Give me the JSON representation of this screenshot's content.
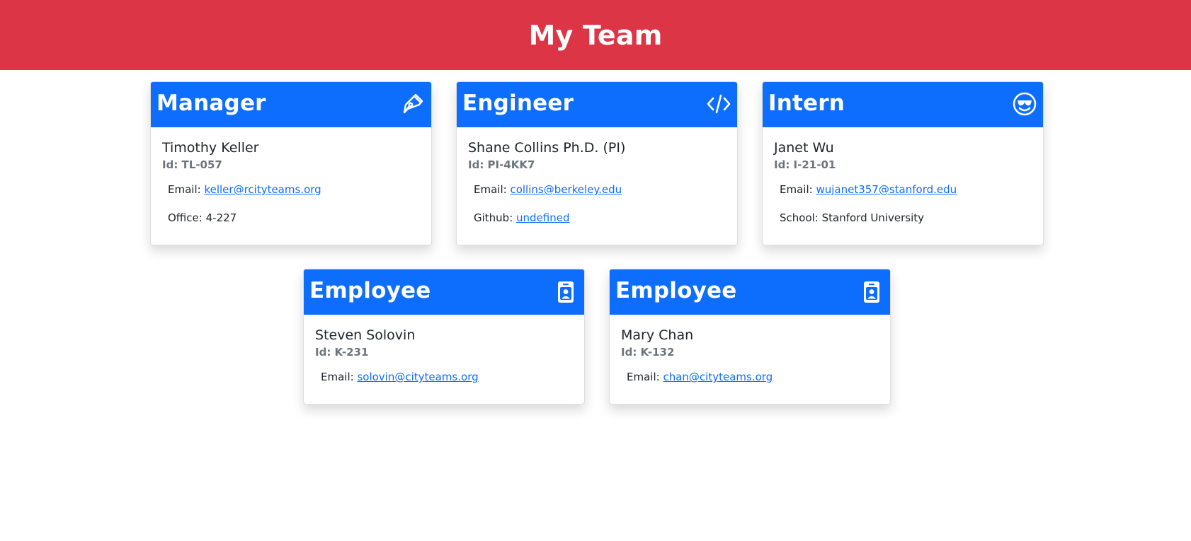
{
  "header": {
    "title": "My Team"
  },
  "cards": [
    {
      "role": "Manager",
      "icon": "pen-icon",
      "name": "Timothy Keller",
      "id_label": "Id: TL-057",
      "email_label": "Email: ",
      "email": "keller@rcityteams.org",
      "extra_label": "Office: ",
      "extra_value": "4-227"
    },
    {
      "role": "Engineer",
      "icon": "code-icon",
      "name": "Shane Collins Ph.D. (PI)",
      "id_label": "Id: PI-4KK7",
      "email_label": "Email: ",
      "email": "collins@berkeley.edu",
      "extra_label": "Github: ",
      "extra_value": "undefined"
    },
    {
      "role": "Intern",
      "icon": "sunglasses-smiley-icon",
      "name": "Janet Wu",
      "id_label": "Id: I-21-01",
      "email_label": "Email: ",
      "email": "wujanet357@stanford.edu",
      "extra_label": "School: ",
      "extra_value": "Stanford University"
    },
    {
      "role": "Employee",
      "icon": "id-badge-icon",
      "name": "Steven Solovin",
      "id_label": "Id: K-231",
      "email_label": "Email: ",
      "email": "solovin@cityteams.org"
    },
    {
      "role": "Employee",
      "icon": "id-badge-icon",
      "name": "Mary Chan",
      "id_label": "Id: K-132",
      "email_label": "Email: ",
      "email": "chan@cityteams.org"
    }
  ],
  "colors": {
    "header_bg": "#dc3545",
    "card_header_bg": "#0d6efd",
    "link": "#0d6efd",
    "muted": "#6c757d"
  }
}
